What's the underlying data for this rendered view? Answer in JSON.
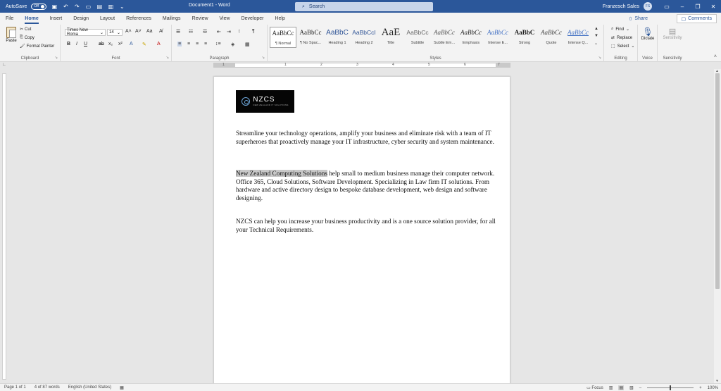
{
  "titlebar": {
    "autosave_label": "AutoSave",
    "autosave_state": "Off",
    "doc_title": "Document1 - Word",
    "search_placeholder": "Search",
    "user_name": "Franzesch Sales",
    "user_initials": "FS"
  },
  "tabs": [
    "File",
    "Home",
    "Insert",
    "Design",
    "Layout",
    "References",
    "Mailings",
    "Review",
    "View",
    "Developer",
    "Help"
  ],
  "active_tab": "Home",
  "share_label": "Share",
  "comments_label": "Comments",
  "ribbon": {
    "clipboard": {
      "paste": "Paste",
      "cut": "Cut",
      "copy": "Copy",
      "format_painter": "Format Painter",
      "label": "Clipboard"
    },
    "font": {
      "name": "Times New Roma",
      "size": "14",
      "label": "Font"
    },
    "paragraph": {
      "label": "Paragraph"
    },
    "styles": {
      "label": "Styles",
      "items": [
        {
          "sample": "AaBbCc",
          "name": "¶ Normal"
        },
        {
          "sample": "AaBbCc",
          "name": "¶ No Spac..."
        },
        {
          "sample": "AaBbC",
          "name": "Heading 1"
        },
        {
          "sample": "AaBbCcI",
          "name": "Heading 2"
        },
        {
          "sample": "AaE",
          "name": "Title"
        },
        {
          "sample": "AaBbCc",
          "name": "Subtitle"
        },
        {
          "sample": "AaBbCc",
          "name": "Subtle Em..."
        },
        {
          "sample": "AaBbCc",
          "name": "Emphasis"
        },
        {
          "sample": "AaBbCc",
          "name": "Intense E..."
        },
        {
          "sample": "AaBbC",
          "name": "Strong"
        },
        {
          "sample": "AaBbCc",
          "name": "Quote"
        },
        {
          "sample": "AaBbCc",
          "name": "Intense Q..."
        }
      ]
    },
    "editing": {
      "find": "Find",
      "replace": "Replace",
      "select": "Select",
      "label": "Editing"
    },
    "voice": {
      "dictate": "Dictate",
      "label": "Voice"
    },
    "sensitivity": {
      "button": "Sensitivity",
      "label": "Sensitivity"
    }
  },
  "ruler_numbers": [
    "1",
    "1",
    "2",
    "3",
    "4",
    "5",
    "6",
    "7"
  ],
  "document": {
    "logo_text": "NZCS",
    "logo_sub": "NEW ZEALAND IT SOLUTIONS",
    "para1": "Streamline your technology operations, amplify your business and eliminate risk with a team of IT superheroes that proactively manage your IT infrastructure, cyber security and system maintenance.",
    "para2_highlight": "New Zealand Computing Solutions",
    "para2_rest": " help small to medium business manage their computer network. Office 365, Cloud Solutions, Software Development. Specializing in Law firm IT solutions. From hardware and active directory design to bespoke database development, web design and software designing.",
    "para3": "NZCS can help you increase your business productivity and is a one source solution provider, for all your Technical Requirements."
  },
  "statusbar": {
    "page": "Page 1 of 1",
    "words": "4 of 87 words",
    "language": "English (United States)",
    "focus": "Focus",
    "zoom": "100%"
  },
  "colors": {
    "accent": "#2b579a",
    "highlight": "#c8c8c8"
  }
}
